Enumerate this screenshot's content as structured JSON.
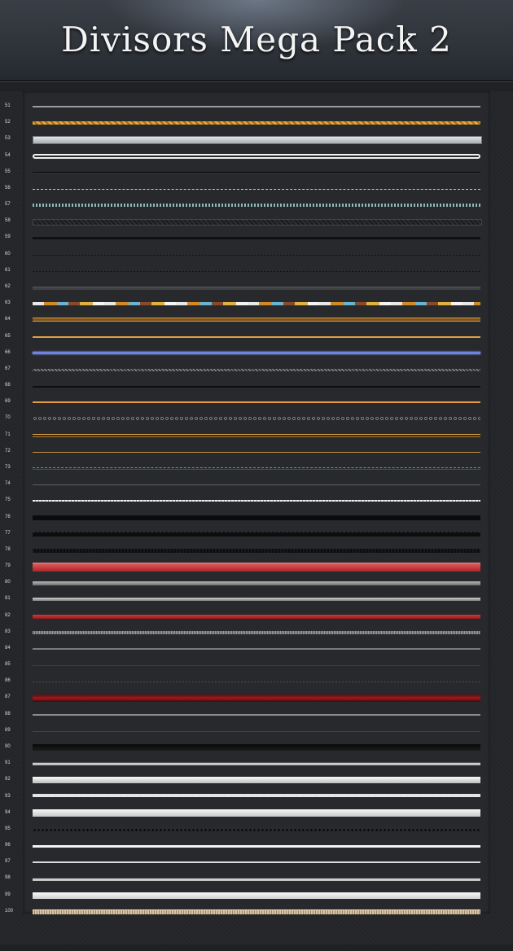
{
  "header": {
    "title": "Divisors Mega Pack 2"
  },
  "rows": [
    {
      "num": "51",
      "style": "thin-white"
    },
    {
      "num": "52",
      "style": "gold-rope"
    },
    {
      "num": "53",
      "style": "silver-bar"
    },
    {
      "num": "54",
      "style": "white-outline"
    },
    {
      "num": "55",
      "style": "dark-groove"
    },
    {
      "num": "56",
      "style": "dashed"
    },
    {
      "num": "57",
      "style": "zigzag-teal"
    },
    {
      "num": "58",
      "style": "hatched-box"
    },
    {
      "num": "59",
      "style": "black"
    },
    {
      "num": "60",
      "style": "dots-dark"
    },
    {
      "num": "61",
      "style": "dots-dark"
    },
    {
      "num": "62",
      "style": "grey-thin"
    },
    {
      "num": "63",
      "style": "multicolor"
    },
    {
      "num": "64",
      "style": "gold-double"
    },
    {
      "num": "65",
      "style": "gold-thin"
    },
    {
      "num": "66",
      "style": "blue"
    },
    {
      "num": "67",
      "style": "grey-hatch"
    },
    {
      "num": "68",
      "style": "black-thin"
    },
    {
      "num": "69",
      "style": "orange"
    },
    {
      "num": "70",
      "style": "circles"
    },
    {
      "num": "71",
      "style": "gold-double2"
    },
    {
      "num": "72",
      "style": "gold-hair"
    },
    {
      "num": "73",
      "style": "teal-dash"
    },
    {
      "num": "74",
      "style": "grey-hair"
    },
    {
      "num": "75",
      "style": "white-wavy"
    },
    {
      "num": "76",
      "style": "black-bar"
    },
    {
      "num": "77",
      "style": "black-dash"
    },
    {
      "num": "78",
      "style": "black-ribbed"
    },
    {
      "num": "79",
      "style": "red-bar"
    },
    {
      "num": "80",
      "style": "grey-bar"
    },
    {
      "num": "81",
      "style": "grey-bar2"
    },
    {
      "num": "82",
      "style": "red-thin"
    },
    {
      "num": "83",
      "style": "grey-ridge"
    },
    {
      "num": "84",
      "style": "grey-line2"
    },
    {
      "num": "85",
      "style": "dim-line"
    },
    {
      "num": "86",
      "style": "dim-dash"
    },
    {
      "num": "87",
      "style": "dark-red"
    },
    {
      "num": "88",
      "style": "grey-2px"
    },
    {
      "num": "89",
      "style": "teal-dark"
    },
    {
      "num": "90",
      "style": "black-shadow"
    },
    {
      "num": "91",
      "style": "white-zigzag-top"
    },
    {
      "num": "92",
      "style": "white-bar"
    },
    {
      "num": "93",
      "style": "white-sawtooth"
    },
    {
      "num": "94",
      "style": "white-bar-big"
    },
    {
      "num": "95",
      "style": "black-dots"
    },
    {
      "num": "96",
      "style": "white-2px"
    },
    {
      "num": "97",
      "style": "white-1px"
    },
    {
      "num": "98",
      "style": "white-zz2"
    },
    {
      "num": "99",
      "style": "white-teeth"
    },
    {
      "num": "100",
      "style": "beige"
    }
  ]
}
